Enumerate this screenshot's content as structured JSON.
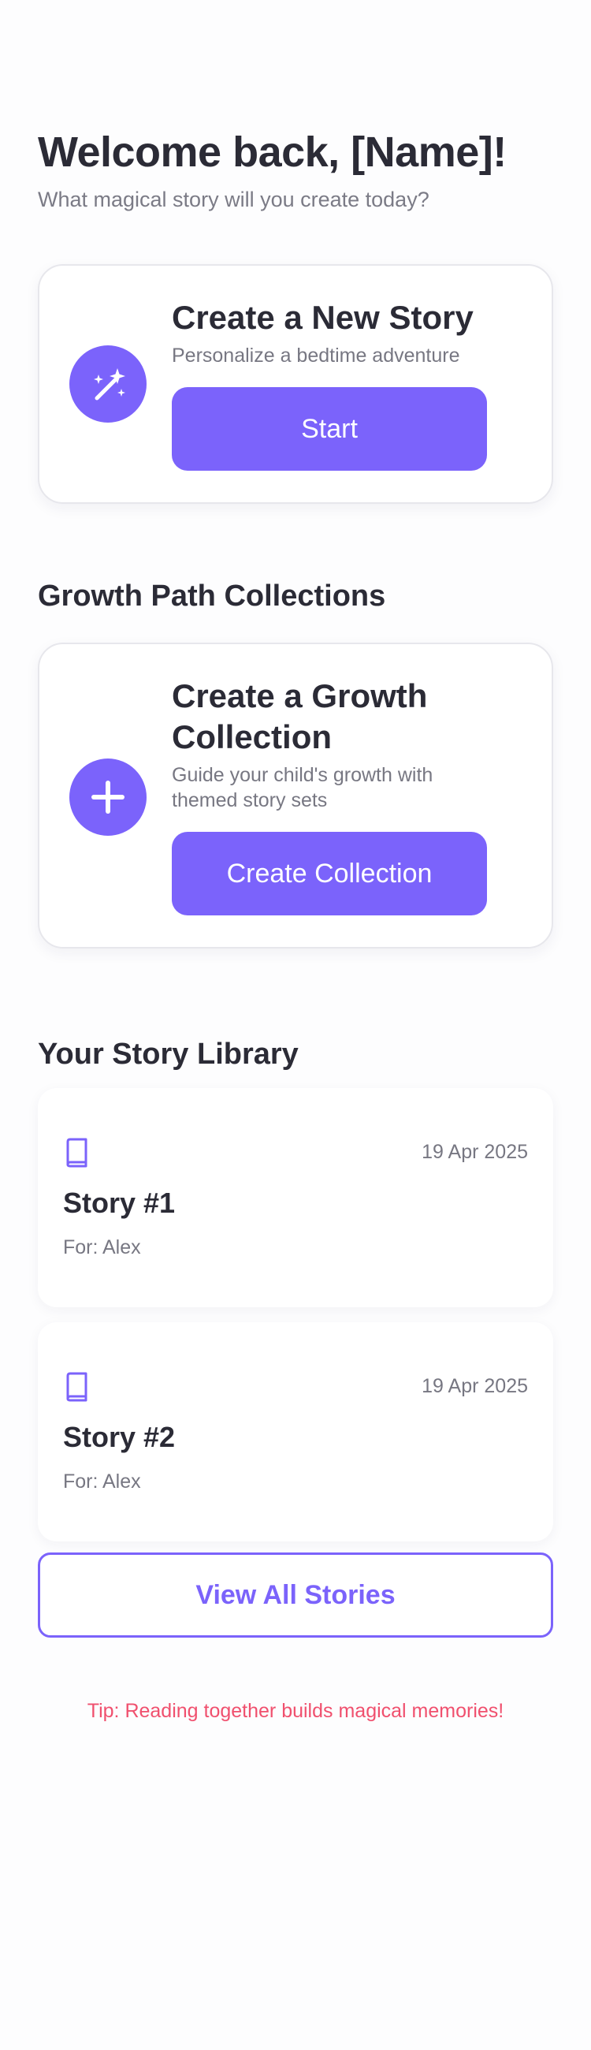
{
  "header": {
    "welcome_title": "Welcome back, [Name]!",
    "welcome_subtitle": "What magical story will you create today?"
  },
  "new_story_card": {
    "icon": "magic-wand-icon",
    "title": "Create a New Story",
    "description": "Personalize a bedtime adventure",
    "button_label": "Start"
  },
  "growth_section": {
    "heading": "Growth Path Collections",
    "card": {
      "icon": "plus-icon",
      "title": "Create a Growth Collection",
      "description": "Guide your child's growth with themed story sets",
      "button_label": "Create Collection"
    }
  },
  "library": {
    "heading": "Your Story Library",
    "stories": [
      {
        "icon": "book-icon",
        "title": "Story #1",
        "for": "For: Alex",
        "date": "19 Apr 2025"
      },
      {
        "icon": "book-icon",
        "title": "Story #2",
        "for": "For: Alex",
        "date": "19 Apr 2025"
      }
    ],
    "view_all_label": "View All Stories"
  },
  "tip": "Tip: Reading together builds magical memories!",
  "colors": {
    "accent": "#7b63fb",
    "tip": "#f0506e",
    "text_primary": "#2b2b36",
    "text_secondary": "#777782"
  }
}
